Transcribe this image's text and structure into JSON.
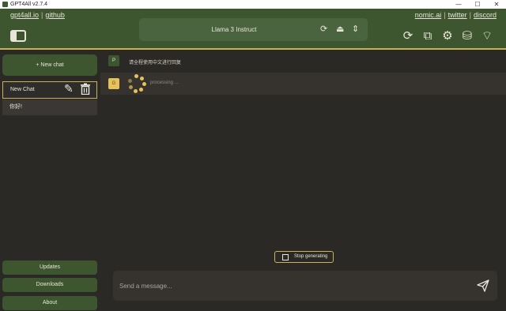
{
  "window": {
    "title": "GPT4All v2.7.4",
    "minimize": "—",
    "maximize": "☐",
    "close": "✕"
  },
  "header": {
    "links_left": [
      "gpt4all.io",
      "github"
    ],
    "links_right": [
      "nomic.ai",
      "twitter",
      "discord"
    ],
    "separator": "|",
    "model_name": "Llama 3 Instruct"
  },
  "icons": {
    "reload": "⟳",
    "eject": "⏏",
    "select": "⇕",
    "sync": "⟳",
    "copy": "⧉",
    "settings": "⚙",
    "database": "⛁",
    "wifi": "⌔",
    "edit": "✎",
    "trash": "🗑"
  },
  "sidebar": {
    "new_chat": "+ New chat",
    "chats": [
      "New Chat",
      "你好!"
    ],
    "buttons": [
      "Updates",
      "Downloads",
      "About"
    ]
  },
  "conversation": {
    "user_avatar": "P",
    "user_message": "请全程使用中文进行回复",
    "bot_avatar": "G",
    "status": "processing ..."
  },
  "controls": {
    "stop_label": "Stop generating",
    "input_placeholder": "Send a message..."
  },
  "colors": {
    "header_green": "#3d5630",
    "accent_gold": "#c9b25a",
    "spinner_yellow": "#e7c25b",
    "background": "#2b2926"
  }
}
